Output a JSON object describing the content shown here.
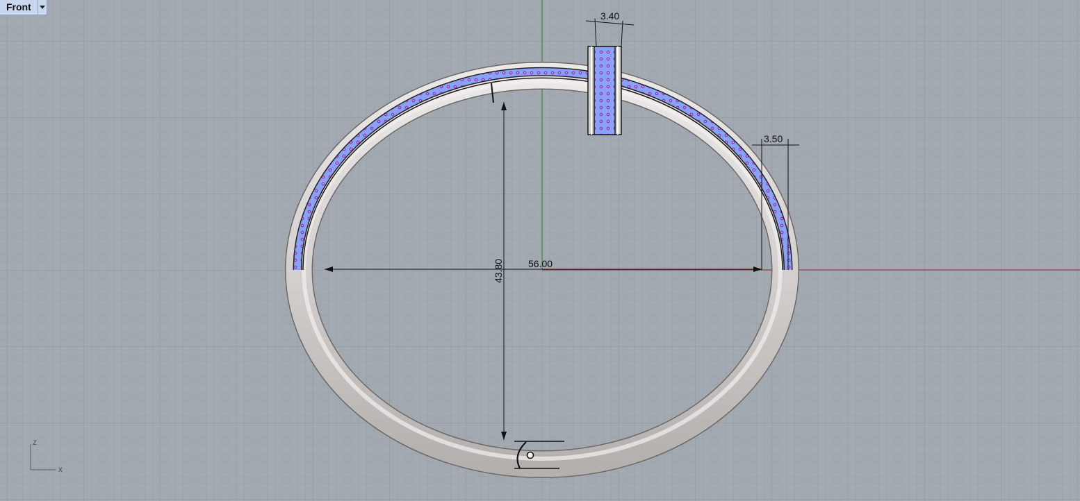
{
  "viewport": {
    "title": "Front",
    "menu_icon": "chevron-down-icon"
  },
  "dimensions": {
    "top_width": "3.40",
    "side_width": "3.50",
    "outer_width": "56.00",
    "outer_height": "43.80"
  },
  "gizmo": {
    "z_label": "z",
    "x_label": "x"
  },
  "colors": {
    "background": "#a3a9b1",
    "grid_minor": "#98a0a8",
    "grid_major": "#8c939b",
    "axis_x": "#9e3a32",
    "axis_y": "#3e8a3e",
    "metal": "#d6d3d1",
    "stones": "#7e95f0",
    "stone_accent": "#8a3fc0"
  }
}
